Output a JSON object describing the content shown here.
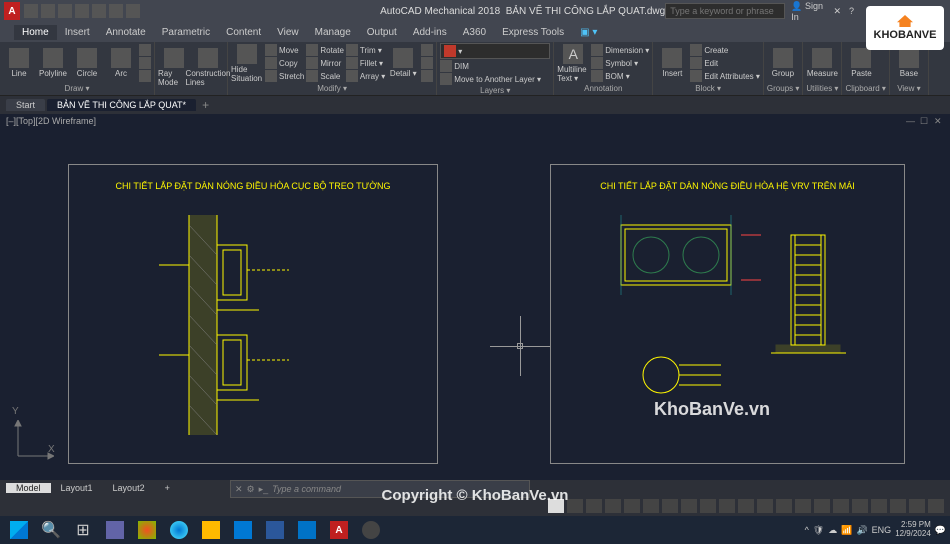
{
  "title": {
    "app": "AutoCAD Mechanical 2018",
    "file": "BẢN VẼ THI CÔNG LẮP QUAT.dwg"
  },
  "search": {
    "placeholder": "Type a keyword or phrase"
  },
  "signin": "Sign In",
  "menu": [
    "Home",
    "Insert",
    "Annotate",
    "Parametric",
    "Content",
    "View",
    "Manage",
    "Output",
    "Add-ins",
    "A360",
    "Express Tools"
  ],
  "ribbon": {
    "draw": {
      "label": "Draw ▾",
      "line": "Line",
      "polyline": "Polyline",
      "circle": "Circle",
      "arc": "Arc"
    },
    "mode": {
      "label": "",
      "ray": "Ray Mode",
      "cons": "Construction Lines"
    },
    "modify": {
      "label": "Modify ▾",
      "hide": "Hide Situation",
      "items": [
        "Move",
        "Copy",
        "Stretch"
      ],
      "items2": [
        "Rotate",
        "Mirror",
        "Scale"
      ],
      "items3": [
        "Trim ▾",
        "Fillet ▾",
        "Array ▾"
      ],
      "detail": "Detail ▾"
    },
    "layers": {
      "label": "Layers ▾",
      "move": "Move to Another Layer ▾"
    },
    "annotation": {
      "label": "Annotation",
      "text": "Multiline Text ▾",
      "items": [
        "Dimension ▾",
        "Symbol ▾",
        "BOM ▾"
      ]
    },
    "insert": {
      "label": "Insert",
      "btn": "Insert",
      "items": [
        "Create",
        "Edit",
        "Edit Attributes ▾"
      ]
    },
    "block": {
      "label": "Block ▾"
    },
    "groups": {
      "label": "Groups ▾",
      "btn": "Group"
    },
    "utilities": {
      "label": "Utilities ▾",
      "btn": "Measure"
    },
    "clipboard": {
      "label": "Clipboard ▾",
      "btn": "Paste"
    },
    "base": {
      "label": "View ▾",
      "btn": "Base"
    }
  },
  "filetabs": {
    "start": "Start",
    "active": "BẢN VẼ THI CÔNG LẮP QUAT*"
  },
  "viewport": {
    "label": "[–][Top][2D Wireframe]"
  },
  "drawings": {
    "title1": "CHI TIẾT LẮP ĐẶT DÀN NÓNG ĐIỀU HÒA CỤC BỘ TREO TƯỜNG",
    "title2": "CHI TIẾT LẮP ĐẶT DÀN NÓNG ĐIỀU HÒA HỆ VRV TRÊN MÁI"
  },
  "watermark": {
    "brand": "KhoBanVe.vn",
    "copyright": "Copyright © KhoBanVe.vn"
  },
  "logo": {
    "line1": "KHOBANVE"
  },
  "bottomtabs": [
    "Model",
    "Layout1",
    "Layout2"
  ],
  "command": {
    "placeholder": "Type a command"
  },
  "ucs": {
    "x": "X",
    "y": "Y"
  },
  "dim": "DIM",
  "tray": {
    "time": "2:59 PM",
    "date": "12/9/2024"
  }
}
